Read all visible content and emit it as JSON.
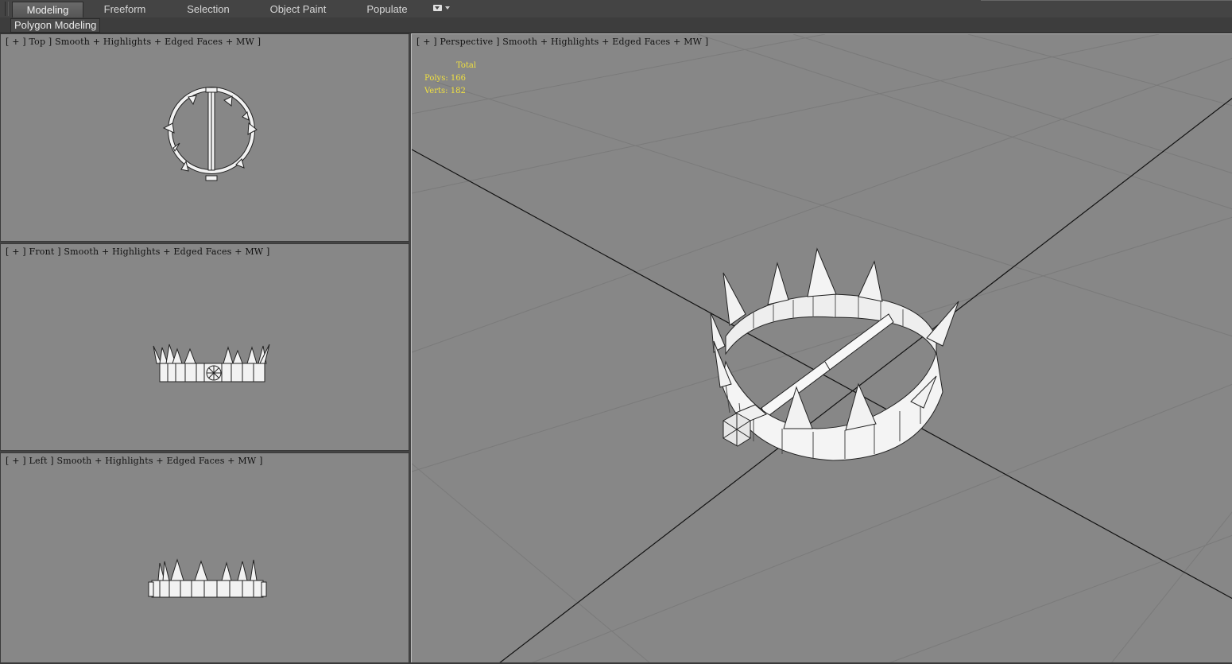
{
  "ribbon": {
    "tabs": [
      {
        "label": "Modeling",
        "active": true
      },
      {
        "label": "Freeform",
        "active": false
      },
      {
        "label": "Selection",
        "active": false
      },
      {
        "label": "Object Paint",
        "active": false
      },
      {
        "label": "Populate",
        "active": false
      }
    ],
    "panel_label": "Polygon Modeling",
    "dropdown_icon": "ribbon-options-dropdown-icon"
  },
  "viewports": {
    "top": {
      "label": "[ + ] Top ] Smooth + Highlights + Edged Faces + MW ]"
    },
    "front": {
      "label": "[ + ] Front ] Smooth + Highlights + Edged Faces + MW ]"
    },
    "left": {
      "label": "[ + ] Left ] Smooth + Highlights + Edged Faces + MW ]"
    },
    "perspective": {
      "label": "[ + ] Perspective ] Smooth + Highlights + Edged Faces + MW ]"
    }
  },
  "stats": {
    "total_label": "Total",
    "polys_label": "Polys:",
    "polys_value": "166",
    "verts_label": "Verts:",
    "verts_value": "182"
  },
  "colors": {
    "viewport_bg": "#878787",
    "ui_bg": "#444444",
    "stats_text": "#f0e040",
    "model": "#f2f2f2"
  }
}
